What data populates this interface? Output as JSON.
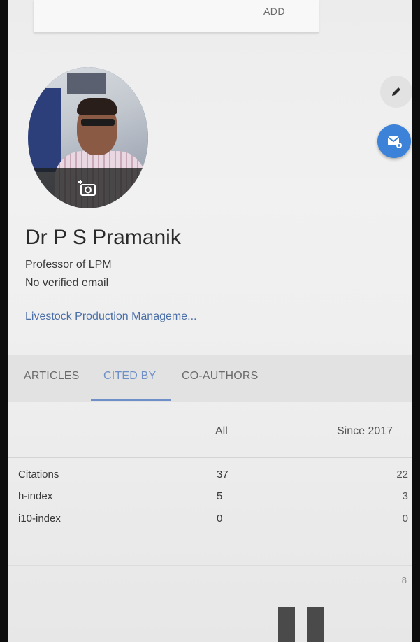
{
  "top_card": {
    "add_label": "ADD"
  },
  "profile": {
    "name": "Dr P S Pramanik",
    "affiliation": "Professor of LPM",
    "email_status": "No verified email",
    "interest": "Livestock Production Manageme..."
  },
  "actions": {
    "edit_icon": "pencil-icon",
    "email_icon": "email-alert-icon",
    "camera_icon": "add-photo-icon"
  },
  "tabs": [
    {
      "label": "ARTICLES",
      "active": false
    },
    {
      "label": "CITED BY",
      "active": true
    },
    {
      "label": "CO-AUTHORS",
      "active": false
    }
  ],
  "citations_table": {
    "headers": {
      "all": "All",
      "since": "Since 2017"
    },
    "rows": [
      {
        "label": "Citations",
        "all": "37",
        "since": "22"
      },
      {
        "label": "h-index",
        "all": "5",
        "since": "3"
      },
      {
        "label": "i10-index",
        "all": "0",
        "since": "0"
      }
    ]
  },
  "graph": {
    "axis_top_value": "8"
  },
  "colors": {
    "accent_blue": "#6f8fc8",
    "email_button": "#3b82d8",
    "link_blue": "#4a6ea8"
  }
}
